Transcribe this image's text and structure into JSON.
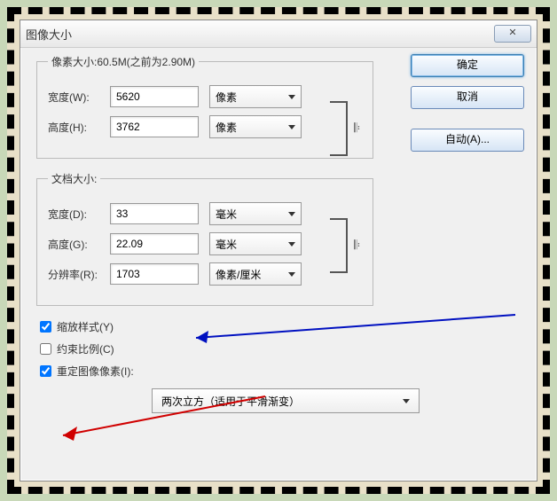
{
  "window": {
    "title": "图像大小"
  },
  "pixelSize": {
    "legend": "像素大小:60.5M(之前为2.90M)",
    "widthLabel": "宽度(W):",
    "widthValue": "5620",
    "widthUnit": "像素",
    "heightLabel": "高度(H):",
    "heightValue": "3762",
    "heightUnit": "像素"
  },
  "docSize": {
    "legend": "文档大小:",
    "widthLabel": "宽度(D):",
    "widthValue": "33",
    "widthUnit": "毫米",
    "heightLabel": "高度(G):",
    "heightValue": "22.09",
    "heightUnit": "毫米",
    "resLabel": "分辨率(R):",
    "resValue": "1703",
    "resUnit": "像素/厘米"
  },
  "checks": {
    "scaleStyles": "缩放样式(Y)",
    "constrain": "约束比例(C)",
    "resample": "重定图像像素(I):"
  },
  "interp": {
    "selected": "两次立方（适用于平滑渐变）"
  },
  "buttons": {
    "ok": "确定",
    "cancel": "取消",
    "auto": "自动(A)..."
  },
  "closeGlyph": "✕"
}
